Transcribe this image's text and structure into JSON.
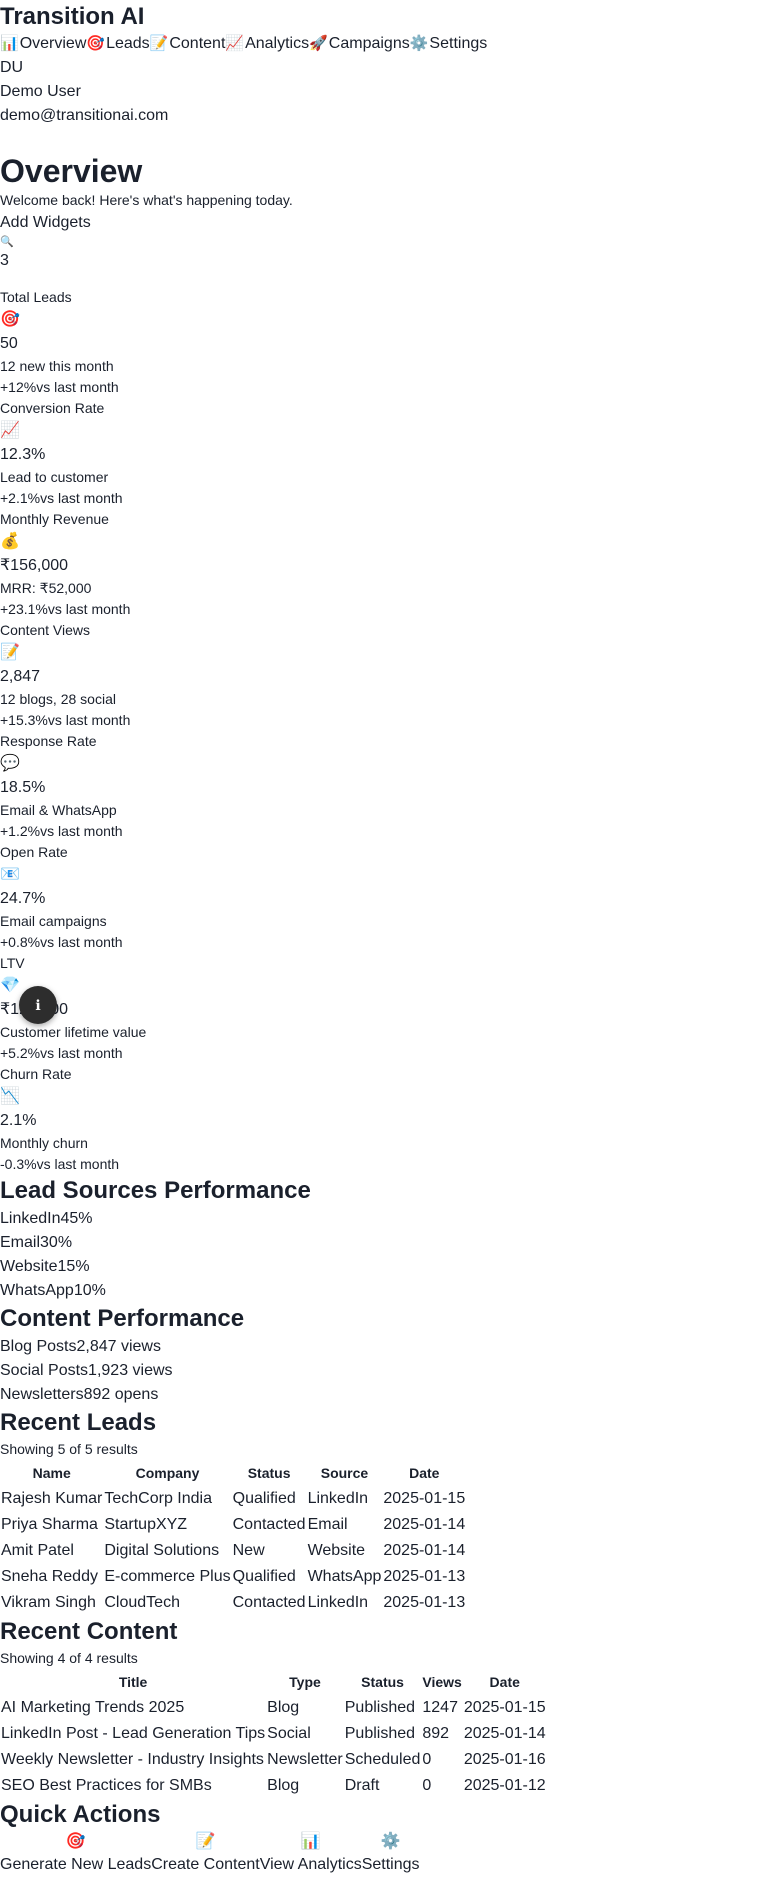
{
  "app": {
    "title": "Transition AI"
  },
  "nav": [
    {
      "icon": "📊",
      "label": "Overview"
    },
    {
      "icon": "🎯",
      "label": "Leads"
    },
    {
      "icon": "📝",
      "label": "Content"
    },
    {
      "icon": "📈",
      "label": "Analytics"
    },
    {
      "icon": "🚀",
      "label": "Campaigns"
    },
    {
      "icon": "⚙️",
      "label": "Settings"
    }
  ],
  "user": {
    "initials": "DU",
    "name": "Demo User",
    "email": "demo@transitionai.com"
  },
  "page": {
    "title": "Overview",
    "subtitle": "Welcome back! Here's what's happening today.",
    "add_widgets": "Add Widgets",
    "widget_icon": "🔍",
    "widget_count": "3"
  },
  "kpis": [
    {
      "label": "Total Leads",
      "icon": "🎯",
      "value": "50",
      "sub": "12 new this month",
      "change": "+12%",
      "change_suffix": "vs last month"
    },
    {
      "label": "Conversion Rate",
      "icon": "📈",
      "value": "12.3%",
      "sub": "Lead to customer",
      "change": "+2.1%",
      "change_suffix": "vs last month"
    },
    {
      "label": "Monthly Revenue",
      "icon": "💰",
      "value": "₹156,000",
      "sub": "MRR: ₹52,000",
      "change": "+23.1%",
      "change_suffix": "vs last month"
    },
    {
      "label": "Content Views",
      "icon": "📝",
      "value": "2,847",
      "sub": "12 blogs, 28 social",
      "change": "+15.3%",
      "change_suffix": "vs last month"
    },
    {
      "label": "Response Rate",
      "icon": "💬",
      "value": "18.5%",
      "sub": "Email & WhatsApp",
      "change": "+1.2%",
      "change_suffix": "vs last month"
    },
    {
      "label": "Open Rate",
      "icon": "📧",
      "value": "24.7%",
      "sub": "Email campaigns",
      "change": "+0.8%",
      "change_suffix": "vs last month"
    },
    {
      "label": "LTV",
      "icon": "💎",
      "value": "₹125,000",
      "sub": "Customer lifetime value",
      "change": "+5.2%",
      "change_suffix": "vs last month"
    },
    {
      "label": "Churn Rate",
      "icon": "📉",
      "value": "2.1%",
      "sub": "Monthly churn",
      "change": "-0.3%",
      "change_suffix": "vs last month"
    }
  ],
  "lead_sources": {
    "title": "Lead Sources Performance",
    "items": [
      {
        "name": "LinkedIn",
        "value": "45%"
      },
      {
        "name": "Email",
        "value": "30%"
      },
      {
        "name": "Website",
        "value": "15%"
      },
      {
        "name": "WhatsApp",
        "value": "10%"
      }
    ]
  },
  "content_performance": {
    "title": "Content Performance",
    "items": [
      {
        "name": "Blog Posts",
        "value": "2,847 views"
      },
      {
        "name": "Social Posts",
        "value": "1,923 views"
      },
      {
        "name": "Newsletters",
        "value": "892 opens"
      }
    ]
  },
  "recent_leads": {
    "title": "Recent Leads",
    "showing": "Showing 5 of 5 results",
    "columns": [
      "Name",
      "Company",
      "Status",
      "Source",
      "Date"
    ],
    "rows": [
      [
        "Rajesh Kumar",
        "TechCorp India",
        "Qualified",
        "LinkedIn",
        "2025-01-15"
      ],
      [
        "Priya Sharma",
        "StartupXYZ",
        "Contacted",
        "Email",
        "2025-01-14"
      ],
      [
        "Amit Patel",
        "Digital Solutions",
        "New",
        "Website",
        "2025-01-14"
      ],
      [
        "Sneha Reddy",
        "E-commerce Plus",
        "Qualified",
        "WhatsApp",
        "2025-01-13"
      ],
      [
        "Vikram Singh",
        "CloudTech",
        "Contacted",
        "LinkedIn",
        "2025-01-13"
      ]
    ]
  },
  "recent_content": {
    "title": "Recent Content",
    "showing": "Showing 4 of 4 results",
    "columns": [
      "Title",
      "Type",
      "Status",
      "Views",
      "Date"
    ],
    "rows": [
      [
        "AI Marketing Trends 2025",
        "Blog",
        "Published",
        "1247",
        "2025-01-15"
      ],
      [
        "LinkedIn Post - Lead Generation Tips",
        "Social",
        "Published",
        "892",
        "2025-01-14"
      ],
      [
        "Weekly Newsletter - Industry Insights",
        "Newsletter",
        "Scheduled",
        "0",
        "2025-01-16"
      ],
      [
        "SEO Best Practices for SMBs",
        "Blog",
        "Draft",
        "0",
        "2025-01-12"
      ]
    ]
  },
  "quick_actions": {
    "title": "Quick Actions",
    "items": [
      {
        "icon": "🎯",
        "label": "Generate New Leads"
      },
      {
        "icon": "📝",
        "label": "Create Content"
      },
      {
        "icon": "📊",
        "label": "View Analytics"
      },
      {
        "icon": "⚙️",
        "label": "Settings"
      }
    ]
  },
  "floating_button": {
    "icon": "ℹ"
  }
}
